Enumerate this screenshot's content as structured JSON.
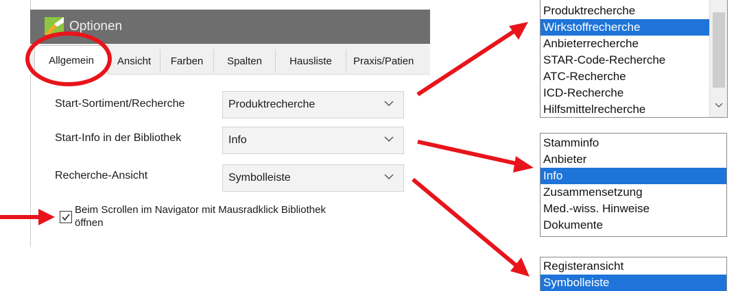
{
  "dialog": {
    "title": "Optionen",
    "tabs": [
      "Allgemein",
      "Ansicht",
      "Farben",
      "Spalten",
      "Hausliste",
      "Praxis/Patien"
    ],
    "settings": [
      {
        "label": "Start-Sortiment/Recherche",
        "value": "Produktrecherche"
      },
      {
        "label": "Start-Info in der Bibliothek",
        "value": "Info"
      },
      {
        "label": "Recherche-Ansicht",
        "value": "Symbolleiste"
      }
    ],
    "checkbox": {
      "line1": "Beim Scrollen im Navigator mit Mausradklick Bibliothek",
      "line2": "öffnen",
      "checked": true
    }
  },
  "popups": {
    "recherche": {
      "items": [
        "Produktrecherche",
        "Wirkstoffrecherche",
        "Anbieterrecherche",
        "STAR-Code-Recherche",
        "ATC-Recherche",
        "ICD-Recherche",
        "Hilfsmittelrecherche"
      ],
      "selected": "Wirkstoffrecherche"
    },
    "info": {
      "items": [
        "Stamminfo",
        "Anbieter",
        "Info",
        "Zusammensetzung",
        "Med.-wiss. Hinweise",
        "Dokumente"
      ],
      "selected": "Info"
    },
    "ansicht": {
      "items": [
        "Registeransicht",
        "Symbolleiste"
      ],
      "selected": "Symbolleiste"
    }
  },
  "colors": {
    "highlight": "#1e74d8",
    "annotation": "#e8141b",
    "titlebar": "#6e6e6e"
  },
  "icons": [
    "app-logo-icon",
    "chevron-down-icon",
    "checkmark-icon",
    "annotation-arrow"
  ]
}
